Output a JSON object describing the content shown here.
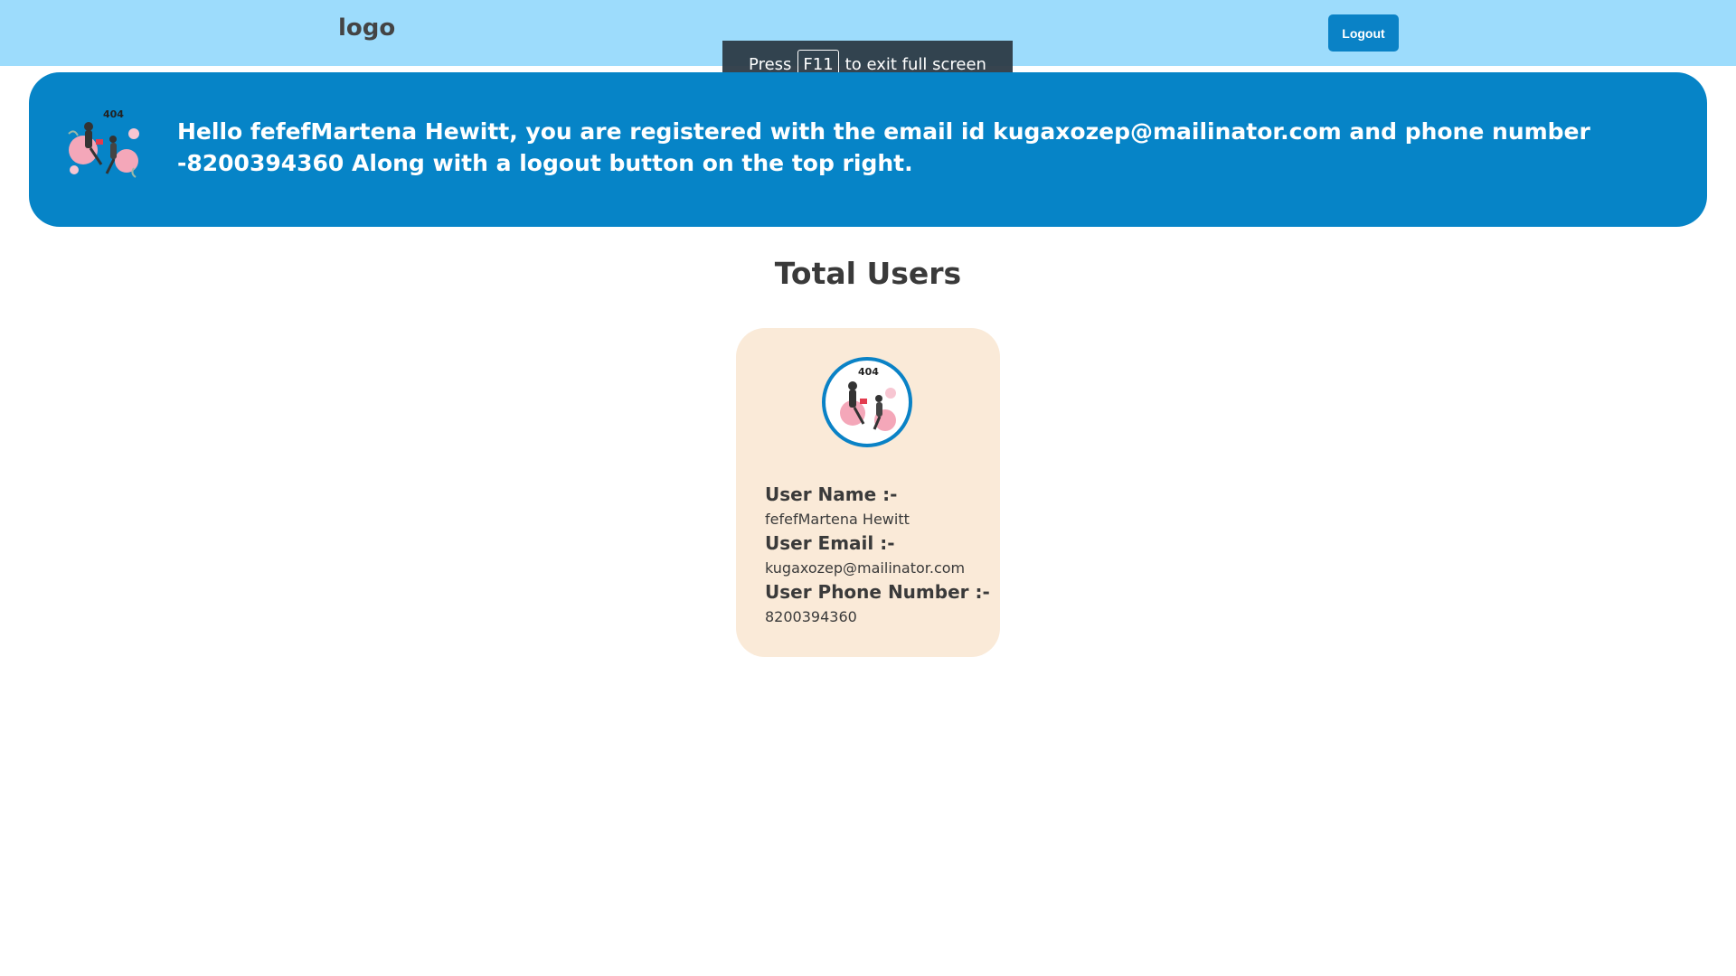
{
  "header": {
    "logo_text": "logo",
    "logout_label": "Logout"
  },
  "fullscreen_notice": {
    "prefix": "Press",
    "key": "F11",
    "suffix": "to exit full screen"
  },
  "banner": {
    "message": "Hello fefefMartena Hewitt, you are registered with the email id kugaxozep@mailinator.com and phone number -8200394360  Along with a logout button on the top right.",
    "illustration_icon": "404-illustration"
  },
  "users_section": {
    "title": "Total Users",
    "user": {
      "avatar_icon": "404-illustration",
      "name_label": "User Name :-",
      "name_value": "fefefMartena Hewitt",
      "email_label": "User Email :-",
      "email_value": "kugaxozep@mailinator.com",
      "phone_label": "User Phone Number :-",
      "phone_value": "8200394360"
    }
  },
  "colors": {
    "header_bg": "#9ddcfc",
    "banner_bg": "#0684c7",
    "button_bg": "#0a82c6",
    "card_bg": "#faead8"
  }
}
